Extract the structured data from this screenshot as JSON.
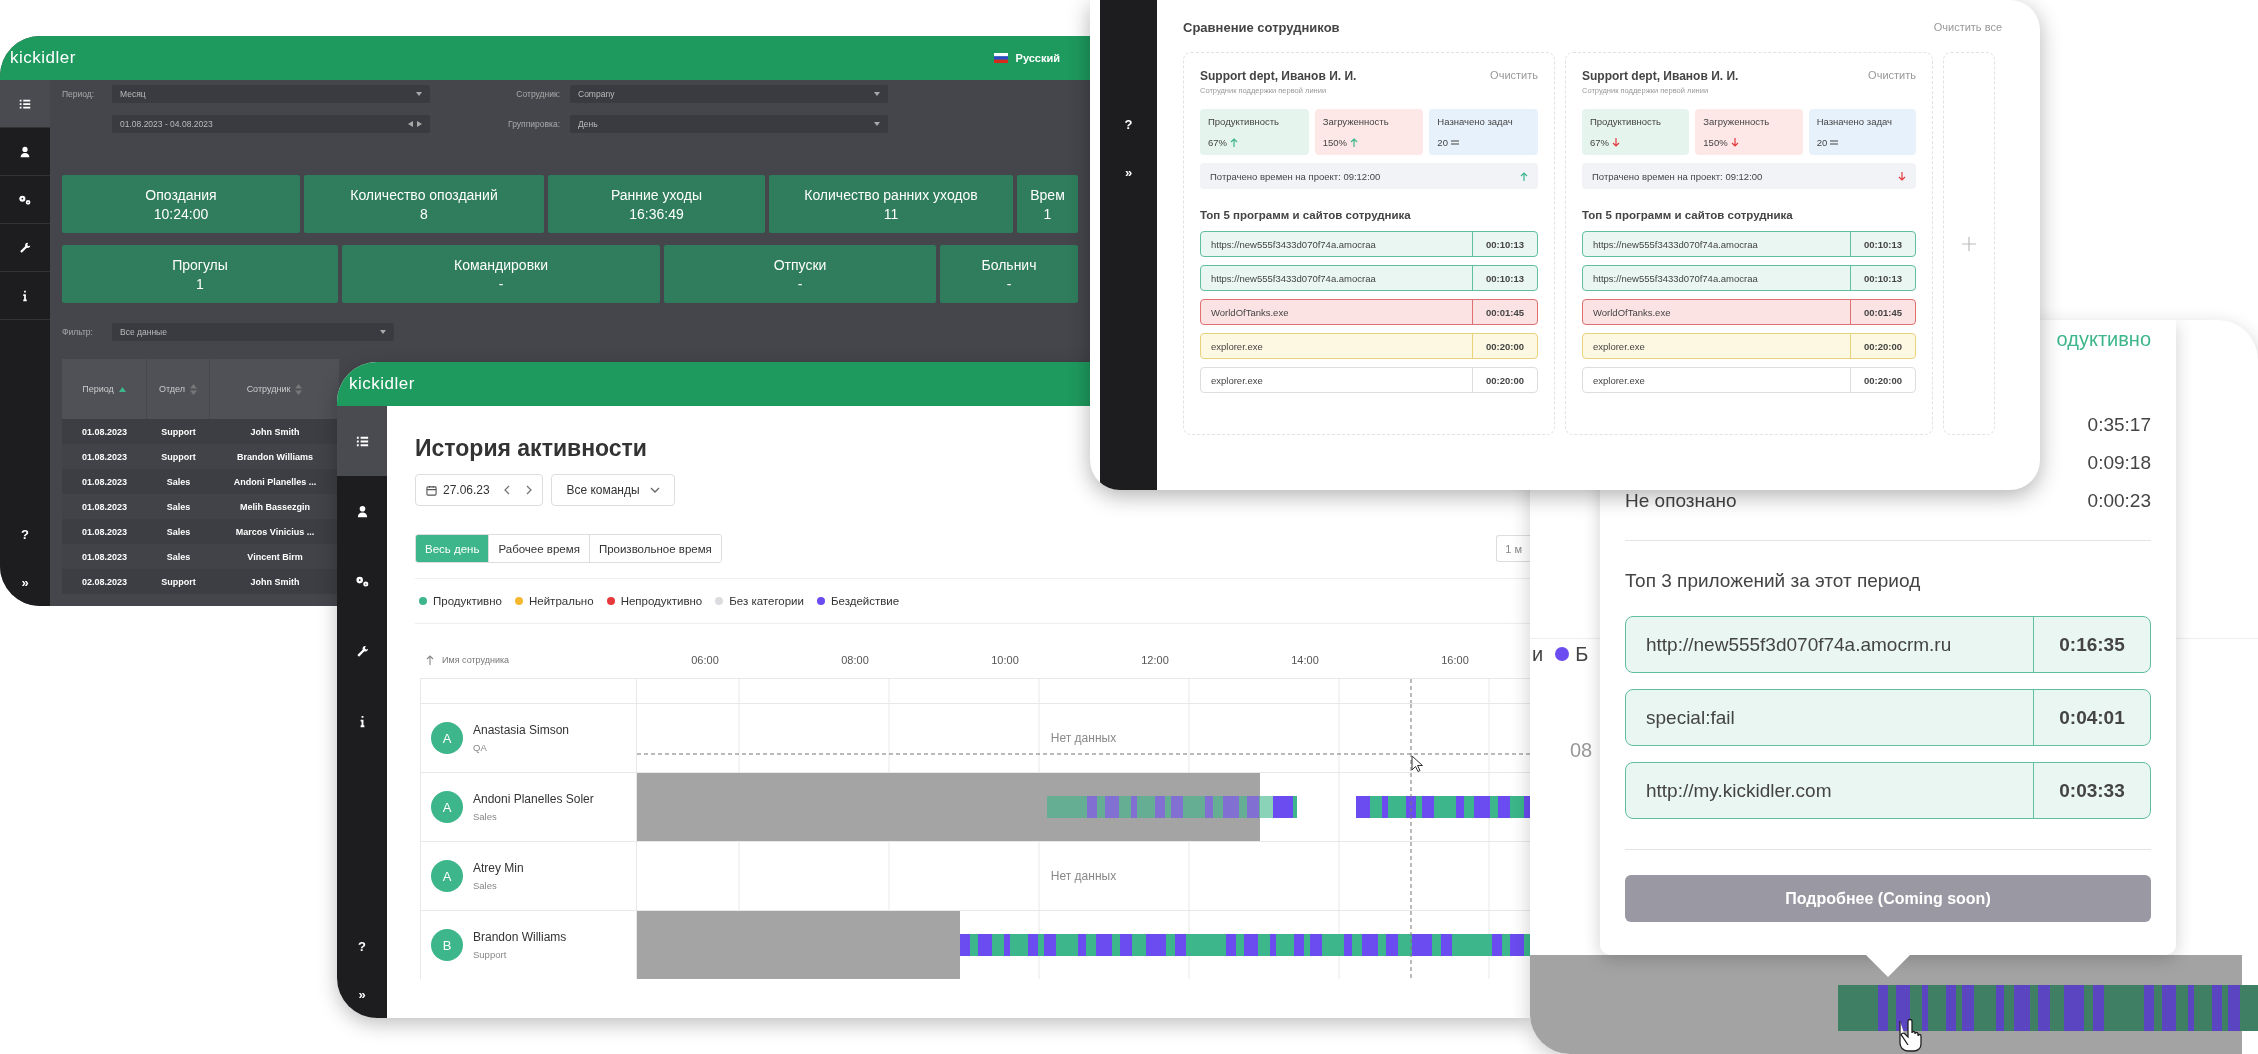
{
  "dashboard": {
    "logo": "kickidler",
    "language": "Русский",
    "sidebar": [
      {
        "selected": true
      },
      {
        "selected": false
      },
      {
        "selected": false
      },
      {
        "selected": false
      },
      {
        "selected": false
      }
    ],
    "help": "?",
    "expand": "»",
    "filters": {
      "period_label": "Период:",
      "period": "Месяц",
      "date_range": "01.08.2023 - 04.08.2023",
      "employee_label": "Сотрудник:",
      "employee": "Company",
      "grouping_label": "Группировка:",
      "grouping": "День",
      "filter_label": "Фильтр:",
      "filter": "Все данные"
    },
    "stat_rows": [
      [
        {
          "label": "Опоздания",
          "value": "10:24:00"
        },
        {
          "label": "Количество опозданий",
          "value": "8"
        },
        {
          "label": "Ранние уходы",
          "value": "16:36:49"
        },
        {
          "label": "Количество ранних уходов",
          "value": "11"
        },
        {
          "label": "Врем",
          "value": "1"
        }
      ],
      [
        {
          "label": "Прогулы",
          "value": "1"
        },
        {
          "label": "Командировки",
          "value": "-"
        },
        {
          "label": "Отпуски",
          "value": "-"
        },
        {
          "label": "Больнич",
          "value": "-"
        }
      ]
    ],
    "table": {
      "columns": [
        {
          "label": "Период",
          "sorted": true
        },
        {
          "label": "Отдел",
          "sorted": false
        },
        {
          "label": "Сотрудник",
          "sorted": false
        }
      ],
      "rows": [
        [
          "01.08.2023",
          "Support",
          "John Smith"
        ],
        [
          "01.08.2023",
          "Support",
          "Brandon Williams"
        ],
        [
          "01.08.2023",
          "Sales",
          "Andoni Planelles ..."
        ],
        [
          "01.08.2023",
          "Sales",
          "Melih Bassezgin"
        ],
        [
          "01.08.2023",
          "Sales",
          "Marcos Vinicius ..."
        ],
        [
          "01.08.2023",
          "Sales",
          "Vincent Birm"
        ],
        [
          "02.08.2023",
          "Support",
          "John Smith"
        ]
      ]
    }
  },
  "activity": {
    "logo": "kickidler",
    "sidebar": [
      {
        "selected": true
      },
      {
        "selected": false
      },
      {
        "selected": false
      },
      {
        "selected": false
      },
      {
        "selected": false
      }
    ],
    "help": "?",
    "expand": "»",
    "title": "История активности",
    "date": "27.06.23",
    "team": "Все команды",
    "range_tabs": [
      {
        "label": "Весь день",
        "selected": true
      },
      {
        "label": "Рабочее время",
        "selected": false
      },
      {
        "label": "Произвольное время",
        "selected": false
      }
    ],
    "zoom": "1 м",
    "legend": [
      {
        "label": "Продуктивно",
        "color": "#3cb68a"
      },
      {
        "label": "Нейтрально",
        "color": "#f5b82e"
      },
      {
        "label": "Непродуктивно",
        "color": "#e5393b"
      },
      {
        "label": "Без категории",
        "color": "#dcdce0"
      },
      {
        "label": "Бездействие",
        "color": "#6a4cf0"
      }
    ],
    "name_header": "Имя сотрудника",
    "hours": [
      "06:00",
      "08:00",
      "10:00",
      "12:00",
      "14:00",
      "16:00"
    ],
    "employees": [
      {
        "initial": "A",
        "name": "Anastasia Simson",
        "team": "QA",
        "kind": "no_data",
        "note": "Нет данных"
      },
      {
        "initial": "A",
        "name": "Andoni Planelles Soler",
        "team": "Sales",
        "kind": "activity"
      },
      {
        "initial": "A",
        "name": "Atrey Min",
        "team": "Sales",
        "kind": "no_data",
        "note": "Нет данных"
      },
      {
        "initial": "B",
        "name": "Brandon Williams",
        "team": "Support",
        "kind": "activity"
      }
    ]
  },
  "comparison": {
    "title": "Сравнение сотрудников",
    "clear_all": "Очистить все",
    "help": "?",
    "expand": "»",
    "cards": [
      {
        "name": "Support dept, Иванов И. И.",
        "role": "Сотрудник поддержки первой линии",
        "clear": "Очистить",
        "metrics": [
          {
            "label": "Продуктивность",
            "value": "67%",
            "kind": "up",
            "color": "#e6f4ee"
          },
          {
            "label": "Загруженность",
            "value": "150%",
            "kind": "up",
            "color": "#fde7e7"
          },
          {
            "label": "Назначено задач",
            "value": "20",
            "kind": "equal",
            "color": "#e7f1fb"
          }
        ],
        "project_time": "Потрачено времен на проект: 09:12:00",
        "project_rising": true,
        "apps_title": "Топ 5 программ и сайтов сотрудника",
        "apps": [
          {
            "name": "https://new555f3433d070f74a.amocraa",
            "time": "00:10:13",
            "kind": "productive"
          },
          {
            "name": "https://new555f3433d070f74a.amocraa",
            "time": "00:10:13",
            "kind": "productive"
          },
          {
            "name": "WorldOfTanks.exe",
            "time": "00:01:45",
            "kind": "unproductive"
          },
          {
            "name": "explorer.exe",
            "time": "00:20:00",
            "kind": "neutral"
          },
          {
            "name": "explorer.exe",
            "time": "00:20:00",
            "kind": "none"
          }
        ]
      },
      {
        "name": "Support dept, Иванов И. И.",
        "role": "Сотрудник поддержки первой линии",
        "clear": "Очистить",
        "metrics": [
          {
            "label": "Продуктивность",
            "value": "67%",
            "kind": "down",
            "color": "#e6f4ee"
          },
          {
            "label": "Загруженность",
            "value": "150%",
            "kind": "down",
            "color": "#fde7e7"
          },
          {
            "label": "Назначено задач",
            "value": "20",
            "kind": "equal",
            "color": "#e7f1fb"
          }
        ],
        "project_time": "Потрачено времен на проект: 09:12:00",
        "project_rising": false,
        "apps_title": "Топ 5 программ и сайтов сотрудника",
        "apps": [
          {
            "name": "https://new555f3433d070f74a.amocraa",
            "time": "00:10:13",
            "kind": "productive"
          },
          {
            "name": "https://new555f3433d070f74a.amocraa",
            "time": "00:10:13",
            "kind": "productive"
          },
          {
            "name": "WorldOfTanks.exe",
            "time": "00:01:45",
            "kind": "unproductive"
          },
          {
            "name": "explorer.exe",
            "time": "00:20:00",
            "kind": "neutral"
          },
          {
            "name": "explorer.exe",
            "time": "00:20:00",
            "kind": "none"
          }
        ]
      }
    ]
  },
  "tooltip": {
    "legend_tail": "и",
    "legend_next": {
      "label": "Б",
      "color": "#6a4cf0"
    },
    "tick": "08",
    "popup": {
      "heading": "одуктивно",
      "stats": [
        {
          "value": "0:35:17"
        },
        {
          "value": "0:09:18"
        },
        {
          "label": "Не опознано",
          "value": "0:00:23"
        }
      ],
      "apps_title": "Топ 3 приложений за этот период",
      "apps": [
        {
          "name": "http://new555f3d070f74a.amocrm.ru",
          "time": "0:16:35",
          "kind": "productive"
        },
        {
          "name": "special:fail",
          "time": "0:04:01",
          "kind": "productive"
        },
        {
          "name": "http://my.kickidler.com",
          "time": "0:03:33",
          "kind": "productive"
        }
      ],
      "button": "Подробнее (Coming soon)"
    }
  }
}
